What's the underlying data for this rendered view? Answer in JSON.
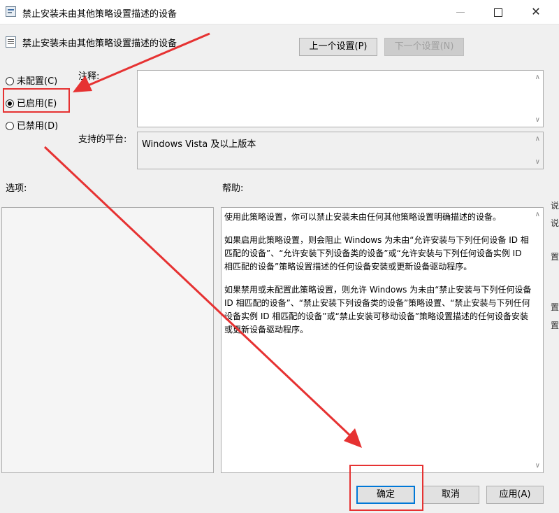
{
  "window": {
    "title": "禁止安装未由其他策略设置描述的设备",
    "controls": {
      "minimize": "—",
      "maximize": "☐",
      "close": "✕"
    }
  },
  "header": {
    "policy_name": "禁止安装未由其他策略设置描述的设备",
    "prev_button": "上一个设置(P)",
    "next_button": "下一个设置(N)"
  },
  "state": {
    "options": [
      {
        "label": "未配置(C)",
        "selected": false
      },
      {
        "label": "已启用(E)",
        "selected": true
      },
      {
        "label": "已禁用(D)",
        "selected": false
      }
    ]
  },
  "comment": {
    "label": "注释:",
    "value": ""
  },
  "platform": {
    "label": "支持的平台:",
    "value": "Windows Vista 及以上版本"
  },
  "options_section": {
    "label": "选项:"
  },
  "help_section": {
    "label": "帮助:",
    "paragraphs": [
      "使用此策略设置，你可以禁止安装未由任何其他策略设置明确描述的设备。",
      "如果启用此策略设置，则会阻止 Windows 为未由“允许安装与下列任何设备 ID 相匹配的设备”、“允许安装下列设备类的设备”或“允许安装与下列任何设备实例 ID 相匹配的设备”策略设置描述的任何设备安装或更新设备驱动程序。",
      "如果禁用或未配置此策略设置，则允许 Windows 为未由“禁止安装与下列任何设备 ID 相匹配的设备”、“禁止安装下列设备类的设备”策略设置、“禁止安装与下列任何设备实例 ID 相匹配的设备”或“禁止安装可移动设备”策略设置描述的任何设备安装或更新设备驱动程序。"
    ]
  },
  "footer": {
    "ok": "确定",
    "cancel": "取消",
    "apply": "应用(A)"
  },
  "edge_fragments": [
    "说",
    "说",
    "置",
    "置",
    "置"
  ],
  "colors": {
    "annotation": "#e63232",
    "focus": "#0078d7"
  }
}
